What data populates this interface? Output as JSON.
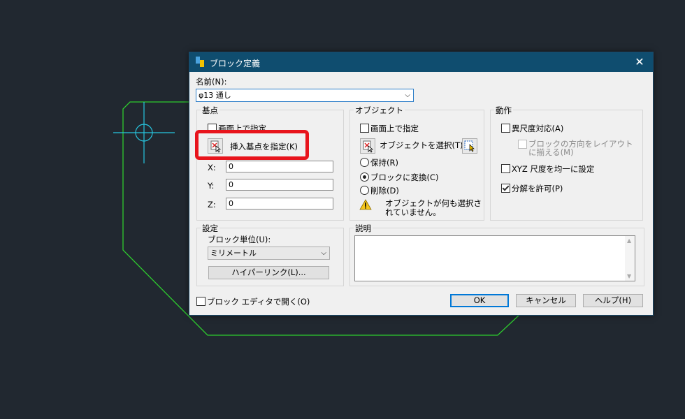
{
  "dialog": {
    "title": "ブロック定義",
    "close_glyph": "✕"
  },
  "name": {
    "label": "名前(N):",
    "value": "φ13 通し"
  },
  "basepoint": {
    "legend": "基点",
    "specify_on_screen": "画面上で指定",
    "pick_button": "挿入基点を指定(K)",
    "x_label": "X:",
    "x_value": "0",
    "y_label": "Y:",
    "y_value": "0",
    "z_label": "Z:",
    "z_value": "0"
  },
  "objects": {
    "legend": "オブジェクト",
    "specify_on_screen": "画面上で指定",
    "select_button": "オブジェクトを選択(T)",
    "retain": "保持(R)",
    "convert": "ブロックに変換(C)",
    "delete": "削除(D)",
    "warning_line1": "オブジェクトが何も選択さ",
    "warning_line2": "れていません。"
  },
  "behavior": {
    "legend": "動作",
    "annotative": "異尺度対応(A)",
    "match_orientation_line1": "ブロックの方向をレイアウト",
    "match_orientation_line2": "に揃える(M)",
    "scale_uniformly": "XYZ 尺度を均一に設定",
    "allow_exploding": "分解を許可(P)"
  },
  "settings": {
    "legend": "設定",
    "unit_label": "ブロック単位(U):",
    "unit_value": "ミリメートル",
    "hyperlink_button": "ハイパーリンク(L)..."
  },
  "description": {
    "legend": "説明"
  },
  "footer": {
    "open_in_editor": "ブロック エディタで開く(O)",
    "ok": "OK",
    "cancel": "キャンセル",
    "help": "ヘルプ(H)"
  },
  "colors": {
    "background": "#212830",
    "drawing_line": "#2ecc2e",
    "center_mark": "#27c6e0",
    "titlebar": "#0f4d6f",
    "highlight": "#e8141c"
  }
}
